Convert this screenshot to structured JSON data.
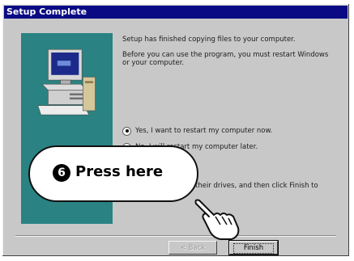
{
  "window": {
    "title": "Setup Complete"
  },
  "message": {
    "line1": "Setup has finished copying files to your computer.",
    "line2": "Before you can use the program, you must restart Windows or your computer.",
    "line3": "their drives, and then click Finish to"
  },
  "options": [
    {
      "label": "Yes, I want to restart my computer now.",
      "checked": true
    },
    {
      "label": "No, I will restart my computer later.",
      "checked": false
    }
  ],
  "buttons": {
    "back": "< Back",
    "finish": "Finish"
  },
  "callout": {
    "number": "6",
    "text": "Press here"
  },
  "icons": {
    "hand": "pointing-hand-icon",
    "computer": "computer-icon"
  }
}
